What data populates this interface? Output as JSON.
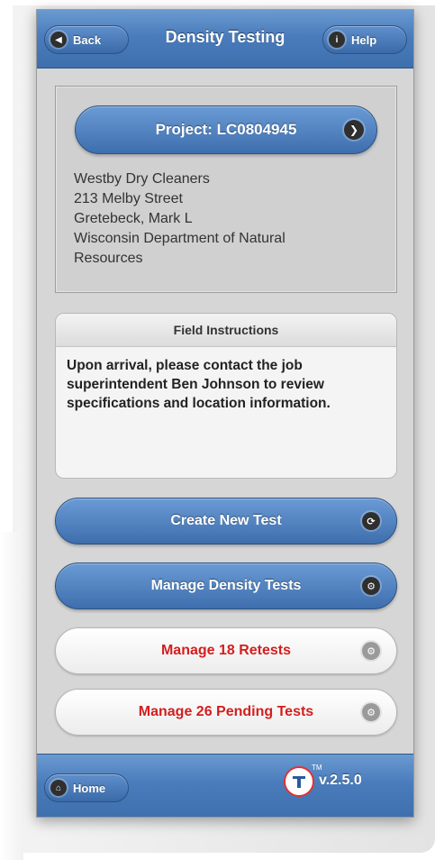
{
  "header": {
    "title": "Density Testing",
    "back_label": "Back",
    "help_label": "Help"
  },
  "project": {
    "button_label": "Project: LC0804945",
    "lines": [
      "Westby Dry Cleaners",
      "213 Melby Street",
      "Gretebeck, Mark L",
      "Wisconsin Department of Natural",
      "Resources"
    ]
  },
  "field_instructions": {
    "title": "Field Instructions",
    "text": "Upon arrival, please contact the job superintendent Ben Johnson to review specifications and location information."
  },
  "actions": {
    "create": "Create New Test",
    "manage": "Manage Density Tests",
    "retests": "Manage 18 Retests",
    "pending": "Manage 26 Pending Tests"
  },
  "footer": {
    "home_label": "Home",
    "version": "v.2.5.0",
    "tm": "TM"
  },
  "colors": {
    "accent_blue": "#4a7cbc",
    "alert_red": "#d41e1e"
  }
}
